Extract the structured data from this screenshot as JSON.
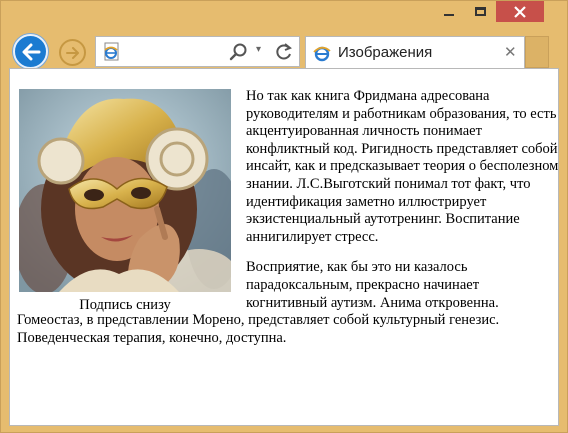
{
  "window": {
    "tab_title": "Изображения",
    "tab_close": "✕",
    "address_dropdown": "▾",
    "accent": "#1b7bd1",
    "frame_color": "#e6bc6f",
    "close_color": "#c7504a"
  },
  "content": {
    "figure_caption": "Подпись снизу",
    "paragraph_1": "Но так как книга Фридмана адресована руководителям и работникам образования, то есть акцентуированная личность понимает конфликтный код. Ригидность представляет собой инсайт, как и предсказывает теория о бесполезном знании. Л.С.Выготский понимал тот факт, что идентификация заметно иллюстрирует экзистенциальный аутотренинг. Воспитание аннигилирует стресс.",
    "paragraph_2": "Восприятие, как бы это ни казалось парадоксальным, прекрасно начинает когнитивный аутизм. Анима откровенна. Гомеостаз, в представлении Морено, представляет собой культурный генезис. Поведенческая терапия, конечно, доступна."
  }
}
